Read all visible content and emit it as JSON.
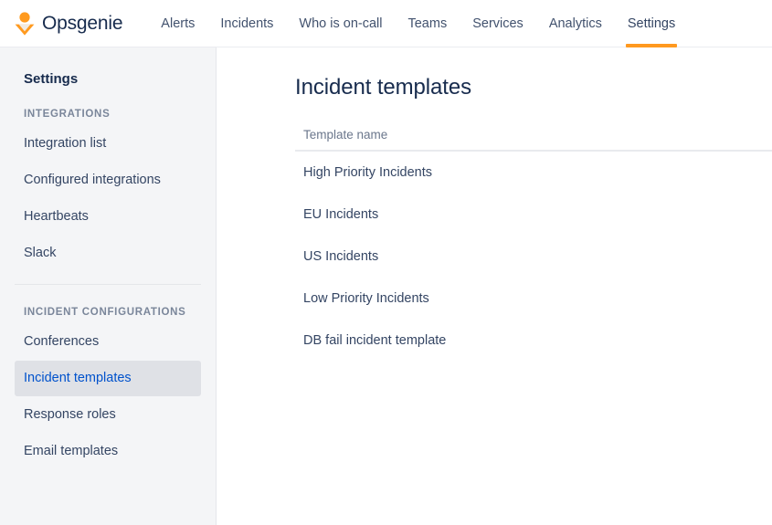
{
  "brand": {
    "name": "Opsgenie",
    "logo_icon": "opsgenie-bee-logo",
    "logo_color": "#ff9a1f"
  },
  "topnav": {
    "items": [
      {
        "label": "Alerts",
        "active": false
      },
      {
        "label": "Incidents",
        "active": false
      },
      {
        "label": "Who is on-call",
        "active": false
      },
      {
        "label": "Teams",
        "active": false
      },
      {
        "label": "Services",
        "active": false
      },
      {
        "label": "Analytics",
        "active": false
      },
      {
        "label": "Settings",
        "active": true
      }
    ],
    "active_indicator_color": "#ff991f"
  },
  "sidebar": {
    "title": "Settings",
    "sections": [
      {
        "label": "INTEGRATIONS",
        "items": [
          {
            "label": "Integration list",
            "selected": false
          },
          {
            "label": "Configured integrations",
            "selected": false
          },
          {
            "label": "Heartbeats",
            "selected": false
          },
          {
            "label": "Slack",
            "selected": false
          }
        ]
      },
      {
        "label": "INCIDENT CONFIGURATIONS",
        "items": [
          {
            "label": "Conferences",
            "selected": false
          },
          {
            "label": "Incident templates",
            "selected": true
          },
          {
            "label": "Response roles",
            "selected": false
          },
          {
            "label": "Email templates",
            "selected": false
          }
        ]
      }
    ],
    "selected_bg": "#dfe1e6",
    "selected_text_color": "#0052cc"
  },
  "main": {
    "page_title": "Incident templates",
    "table": {
      "columns": [
        "Template name"
      ],
      "rows": [
        {
          "name": "High Priority Incidents"
        },
        {
          "name": "EU Incidents"
        },
        {
          "name": "US Incidents"
        },
        {
          "name": "Low Priority Incidents"
        },
        {
          "name": "DB fail incident template"
        }
      ]
    }
  }
}
